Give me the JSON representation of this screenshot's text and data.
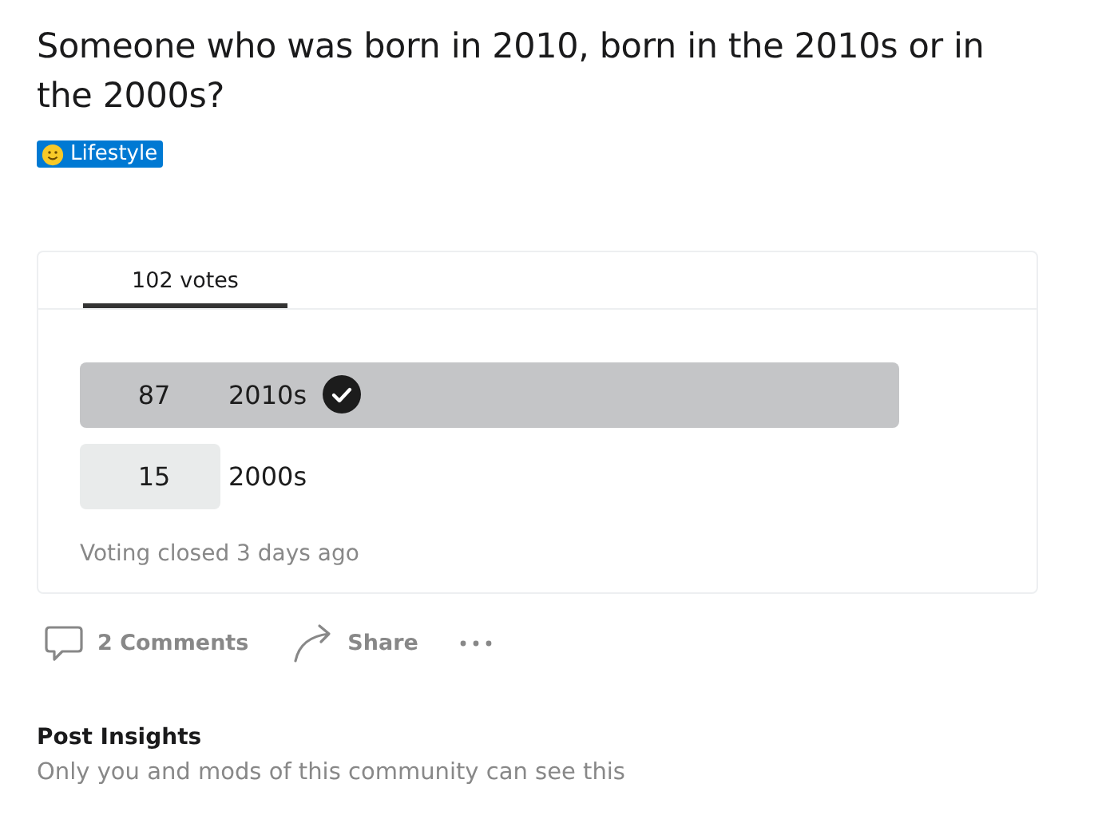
{
  "post": {
    "title": "Someone who was born in 2010, born in the 2010s or in the 2000s?",
    "flair": "Lifestyle"
  },
  "poll": {
    "tab": {
      "label": "102 votes",
      "selected": true
    },
    "options": [
      {
        "count": "87",
        "label": "2010s",
        "level": 0.853,
        "selected": true
      },
      {
        "count": "15",
        "label": "2000s",
        "level": 0.147,
        "selected": false
      }
    ],
    "status": "Voting closed 3 days ago"
  },
  "actions": {
    "comments": "2 Comments",
    "share": "Share"
  },
  "insights": {
    "title": "Post Insights",
    "note": "Only you and mods of this community can see this"
  }
}
